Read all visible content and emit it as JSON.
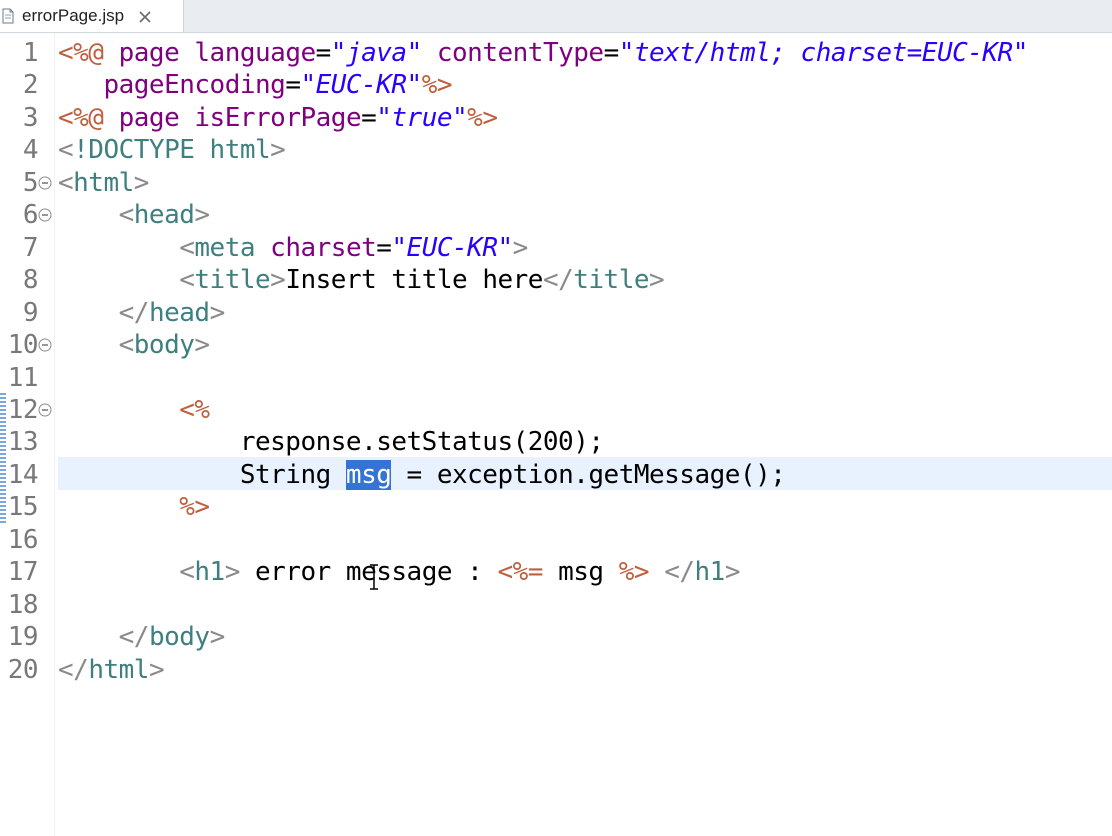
{
  "tab": {
    "label": "errorPage.jsp",
    "icon": "jsp-file-icon",
    "close_icon": "close-icon"
  },
  "colors": {
    "jsp_delimiter": "#bf5f3f",
    "tag_name": "#3f7f7f",
    "attribute": "#7f007f",
    "attribute_value": "#2a00ff",
    "selection": "#3374d6",
    "current_line": "#e8f2fe"
  },
  "editor": {
    "selected_word": "msg",
    "current_line_number": "14",
    "lines": [
      {
        "number": "1",
        "tokens": [
          [
            "jsp",
            "<%@"
          ],
          [
            "plain",
            " "
          ],
          [
            "attr",
            "page"
          ],
          [
            "plain",
            " "
          ],
          [
            "attr",
            "language"
          ],
          [
            "plain",
            "="
          ],
          [
            "val",
            "\"java\""
          ],
          [
            "plain",
            " "
          ],
          [
            "attr",
            "contentType"
          ],
          [
            "plain",
            "="
          ],
          [
            "val",
            "\"text/html; charset=EUC-KR\""
          ]
        ]
      },
      {
        "number": "2",
        "tokens": [
          [
            "plain",
            "   "
          ],
          [
            "attr",
            "pageEncoding"
          ],
          [
            "plain",
            "="
          ],
          [
            "val",
            "\"EUC-KR\""
          ],
          [
            "jsp",
            "%>"
          ]
        ]
      },
      {
        "number": "3",
        "tokens": [
          [
            "jsp",
            "<%@"
          ],
          [
            "plain",
            " "
          ],
          [
            "attr",
            "page"
          ],
          [
            "plain",
            " "
          ],
          [
            "attr",
            "isErrorPage"
          ],
          [
            "plain",
            "="
          ],
          [
            "val",
            "\"true\""
          ],
          [
            "jsp",
            "%>"
          ]
        ]
      },
      {
        "number": "4",
        "tokens": [
          [
            "bracket",
            "<"
          ],
          [
            "tag",
            "!DOCTYPE html"
          ],
          [
            "bracket",
            ">"
          ]
        ]
      },
      {
        "number": "5",
        "fold": true,
        "tokens": [
          [
            "bracket",
            "<"
          ],
          [
            "tag",
            "html"
          ],
          [
            "bracket",
            ">"
          ]
        ]
      },
      {
        "number": "6",
        "fold": true,
        "tokens": [
          [
            "plain",
            "    "
          ],
          [
            "bracket",
            "<"
          ],
          [
            "tag",
            "head"
          ],
          [
            "bracket",
            ">"
          ]
        ]
      },
      {
        "number": "7",
        "tokens": [
          [
            "plain",
            "        "
          ],
          [
            "bracket",
            "<"
          ],
          [
            "tag",
            "meta"
          ],
          [
            "plain",
            " "
          ],
          [
            "attr",
            "charset"
          ],
          [
            "plain",
            "="
          ],
          [
            "val",
            "\"EUC-KR\""
          ],
          [
            "bracket",
            ">"
          ]
        ]
      },
      {
        "number": "8",
        "tokens": [
          [
            "plain",
            "        "
          ],
          [
            "bracket",
            "<"
          ],
          [
            "tag",
            "title"
          ],
          [
            "bracket",
            ">"
          ],
          [
            "plain",
            "Insert title here"
          ],
          [
            "bracket",
            "</"
          ],
          [
            "tag",
            "title"
          ],
          [
            "bracket",
            ">"
          ]
        ]
      },
      {
        "number": "9",
        "tokens": [
          [
            "plain",
            "    "
          ],
          [
            "bracket",
            "</"
          ],
          [
            "tag",
            "head"
          ],
          [
            "bracket",
            ">"
          ]
        ]
      },
      {
        "number": "10",
        "fold": true,
        "tokens": [
          [
            "plain",
            "    "
          ],
          [
            "bracket",
            "<"
          ],
          [
            "tag",
            "body"
          ],
          [
            "bracket",
            ">"
          ]
        ]
      },
      {
        "number": "11",
        "tokens": []
      },
      {
        "number": "12",
        "fold": true,
        "tokens": [
          [
            "plain",
            "        "
          ],
          [
            "jsp",
            "<%"
          ]
        ]
      },
      {
        "number": "13",
        "tokens": [
          [
            "plain",
            "            response.setStatus(200);"
          ]
        ]
      },
      {
        "number": "14",
        "tokens": [
          [
            "plain",
            "            String "
          ],
          [
            "sel",
            "msg"
          ],
          [
            "plain",
            " = exception.getMessage();"
          ]
        ]
      },
      {
        "number": "15",
        "tokens": [
          [
            "plain",
            "        "
          ],
          [
            "jsp",
            "%>"
          ]
        ]
      },
      {
        "number": "16",
        "tokens": []
      },
      {
        "number": "17",
        "tokens": [
          [
            "plain",
            "        "
          ],
          [
            "bracket",
            "<"
          ],
          [
            "tag",
            "h1"
          ],
          [
            "bracket",
            ">"
          ],
          [
            "plain",
            " error message : "
          ],
          [
            "jsp",
            "<%="
          ],
          [
            "plain",
            " msg "
          ],
          [
            "jsp",
            "%>"
          ],
          [
            "plain",
            " "
          ],
          [
            "bracket",
            "</"
          ],
          [
            "tag",
            "h1"
          ],
          [
            "bracket",
            ">"
          ]
        ]
      },
      {
        "number": "18",
        "tokens": []
      },
      {
        "number": "19",
        "tokens": [
          [
            "plain",
            "    "
          ],
          [
            "bracket",
            "</"
          ],
          [
            "tag",
            "body"
          ],
          [
            "bracket",
            ">"
          ]
        ]
      },
      {
        "number": "20",
        "tokens": [
          [
            "bracket",
            "</"
          ],
          [
            "tag",
            "html"
          ],
          [
            "bracket",
            ">"
          ]
        ]
      }
    ]
  }
}
